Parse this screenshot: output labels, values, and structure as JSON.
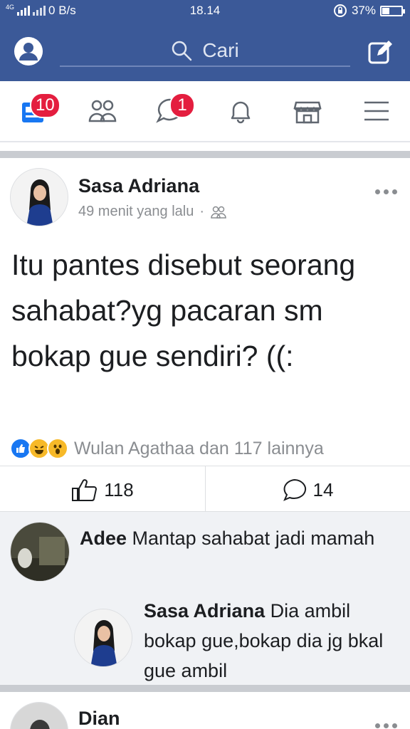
{
  "status_bar": {
    "network": "4G",
    "data_speed": "0 B/s",
    "time": "18.14",
    "battery": "37%",
    "battery_level": 0.37
  },
  "header": {
    "search_placeholder": "Cari",
    "profile_icon": "profile-icon",
    "compose_icon": "compose-icon"
  },
  "nav": {
    "items": [
      {
        "name": "news-feed",
        "icon": "news-feed-icon",
        "badge": "10"
      },
      {
        "name": "friends",
        "icon": "friends-icon",
        "badge": ""
      },
      {
        "name": "messages",
        "icon": "messenger-icon",
        "badge": "1"
      },
      {
        "name": "notifications",
        "icon": "bell-icon",
        "badge": ""
      },
      {
        "name": "marketplace",
        "icon": "marketplace-icon",
        "badge": ""
      },
      {
        "name": "menu",
        "icon": "menu-icon",
        "badge": ""
      }
    ]
  },
  "post": {
    "author": "Sasa Adriana",
    "time": "49 menit yang lalu",
    "separator": "·",
    "privacy_icon": "friends-icon",
    "text": "Itu pantes disebut seorang sahabat?yg pacaran sm bokap gue sendiri? ((:",
    "reactions_text": "Wulan Agathaa dan 117 lainnya",
    "reaction_icons": [
      "like-icon",
      "haha-icon",
      "wow-icon"
    ],
    "like_count": "118",
    "comment_count": "14"
  },
  "comments": [
    {
      "author": "Adee",
      "text": "Mantap sahabat jadi mamah"
    },
    {
      "author": "Sasa Adriana",
      "text": "Dia ambil bokap gue,bokap dia jg bkal gue ambil"
    }
  ],
  "next_post": {
    "author": "Dian"
  },
  "colors": {
    "brand": "#3b5998",
    "badge": "#e41e3f",
    "like": "#1877f2",
    "divider": "#c9ccd1"
  }
}
